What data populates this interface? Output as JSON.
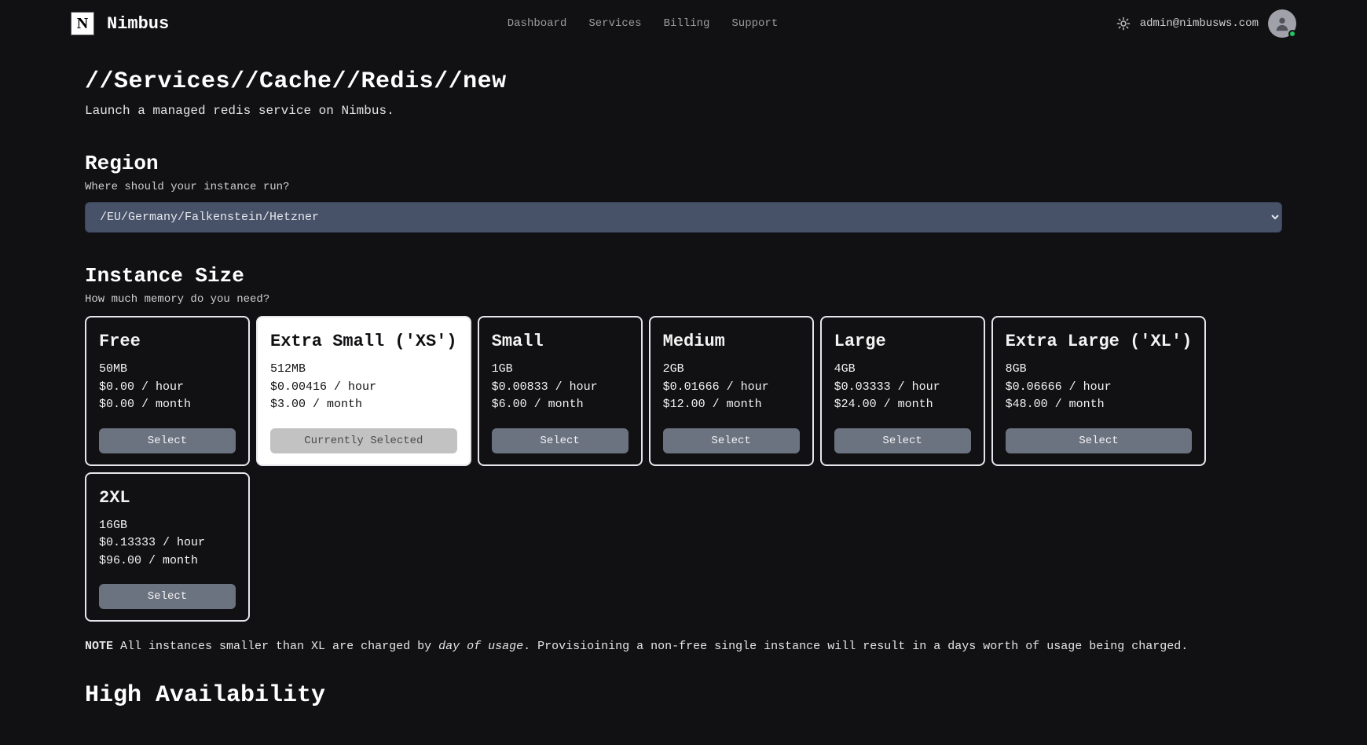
{
  "header": {
    "brand": "Nimbus",
    "logo_letter": "N",
    "nav": [
      "Dashboard",
      "Services",
      "Billing",
      "Support"
    ],
    "user_email": "admin@nimbusws.com"
  },
  "breadcrumb": "//Services//Cache//Redis//new",
  "subtitle": "Launch a managed redis service on Nimbus.",
  "region": {
    "title": "Region",
    "sub": "Where should your instance run?",
    "selected": "/EU/Germany/Falkenstein/Hetzner"
  },
  "size": {
    "title": "Instance Size",
    "sub": "How much memory do you need?",
    "select_label": "Select",
    "selected_label": "Currently Selected",
    "cards": [
      {
        "name": "Free",
        "mem": "50MB",
        "hour": "$0.00 / hour",
        "month": "$0.00 / month",
        "selected": false
      },
      {
        "name": "Extra Small ('XS')",
        "mem": "512MB",
        "hour": "$0.00416 / hour",
        "month": "$3.00 / month",
        "selected": true
      },
      {
        "name": "Small",
        "mem": "1GB",
        "hour": "$0.00833 / hour",
        "month": "$6.00 / month",
        "selected": false
      },
      {
        "name": "Medium",
        "mem": "2GB",
        "hour": "$0.01666 / hour",
        "month": "$12.00 / month",
        "selected": false
      },
      {
        "name": "Large",
        "mem": "4GB",
        "hour": "$0.03333 / hour",
        "month": "$24.00 / month",
        "selected": false
      },
      {
        "name": "Extra Large ('XL')",
        "mem": "8GB",
        "hour": "$0.06666 / hour",
        "month": "$48.00 / month",
        "selected": false
      },
      {
        "name": "2XL",
        "mem": "16GB",
        "hour": "$0.13333 / hour",
        "month": "$96.00 / month",
        "selected": false
      }
    ]
  },
  "note": {
    "label": "NOTE",
    "part1": " All instances smaller than XL are charged by ",
    "em": "day of usage",
    "part2": ". Provisioining a non-free single instance will result in a days worth of usage being charged."
  },
  "ha": {
    "title": "High Availability"
  }
}
